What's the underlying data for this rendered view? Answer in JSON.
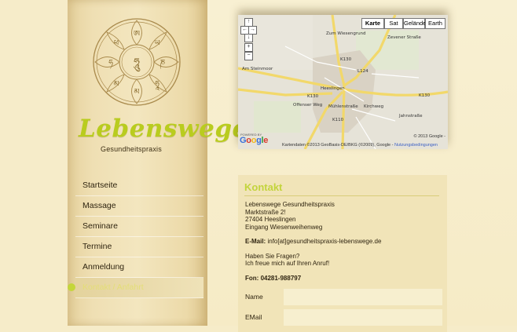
{
  "brand": {
    "name": "Lebenswege",
    "subtitle": "Gesundheitspraxis"
  },
  "nav": {
    "items": [
      {
        "label": "Startseite"
      },
      {
        "label": "Massage"
      },
      {
        "label": "Seminare"
      },
      {
        "label": "Termine"
      },
      {
        "label": "Anmeldung"
      },
      {
        "label": "Kontakt / Anfahrt",
        "active": true
      }
    ]
  },
  "map": {
    "types": [
      "Karte",
      "Sat",
      "Gelände",
      "Earth"
    ],
    "selected_type": "Karte",
    "places": {
      "town": "Heeslingen",
      "roads": [
        "K130",
        "K130",
        "K130",
        "L124",
        "K110",
        "Am Steinmoor",
        "Offenser Weg",
        "Zum Wiesengrund",
        "Zevener Straße",
        "Kirchweg",
        "Jahnstraße",
        "Mühlenstraße"
      ]
    },
    "copyright": "© 2013 Google -",
    "footer_text": "Kartendaten ©2013 GeoBasis-DE/BKG (©2009), Google -",
    "footer_link": "Nutzungsbedingungen",
    "powered_by": "POWERED BY",
    "google_logo": "Google",
    "controls": [
      "↑",
      "←",
      "→",
      "↓",
      "+",
      "−"
    ]
  },
  "contact": {
    "title": "Kontakt",
    "address_lines": [
      "Lebenswege Gesundheitspraxis",
      "Marktstraße 2!",
      "27404 Heeslingen",
      "Eingang Wiesenweihenweg"
    ],
    "email_label": "E-Mail:",
    "email_value": "info[at]gesundheitspraxis-lebenswege.de",
    "question_lines": [
      "Haben Sie Fragen?",
      "Ich freue mich auf Ihren Anruf!"
    ],
    "phone_label": "Fon:",
    "phone_value": "04281-988797"
  },
  "form": {
    "name_label": "Name",
    "email_label": "EMail",
    "name_value": "",
    "email_value": ""
  },
  "colors": {
    "accent": "#c3d43c",
    "background": "#f6ecc9",
    "sidebar": "#efdfb3"
  }
}
